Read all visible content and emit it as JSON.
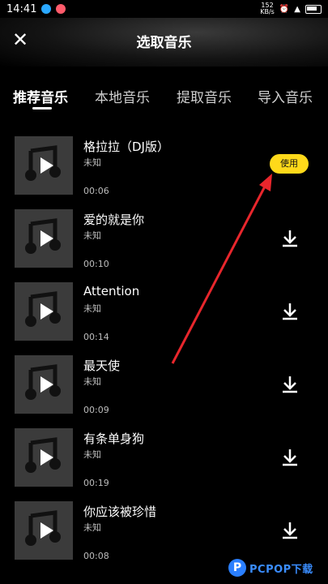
{
  "status_bar": {
    "time": "14:41",
    "speed_value": "152",
    "speed_unit": "KB/s",
    "battery": "battery-icon"
  },
  "header": {
    "title": "选取音乐",
    "close_icon": "close-icon"
  },
  "tabs": [
    {
      "label": "推荐音乐",
      "active": true
    },
    {
      "label": "本地音乐",
      "active": false
    },
    {
      "label": "提取音乐",
      "active": false
    },
    {
      "label": "导入音乐",
      "active": false
    }
  ],
  "songs": [
    {
      "title": "格拉拉（DJ版）",
      "artist": "未知",
      "duration": "00:06",
      "action": "使用"
    },
    {
      "title": "爱的就是你",
      "artist": "未知",
      "duration": "00:10",
      "action": "download-icon"
    },
    {
      "title": "Attention",
      "artist": "未知",
      "duration": "00:14",
      "action": "download-icon"
    },
    {
      "title": "最天使",
      "artist": "未知",
      "duration": "00:09",
      "action": "download-icon"
    },
    {
      "title": "有条单身狗",
      "artist": "未知",
      "duration": "00:19",
      "action": "download-icon"
    },
    {
      "title": "你应该被珍惜",
      "artist": "未知",
      "duration": "00:08",
      "action": "download-icon"
    }
  ],
  "watermark": {
    "logo": "P",
    "text": "PCPOP下载"
  },
  "colors": {
    "accent_yellow": "#ffd91a",
    "arrow_red": "#e8262c",
    "thumb_bg": "#3b3b3b"
  }
}
